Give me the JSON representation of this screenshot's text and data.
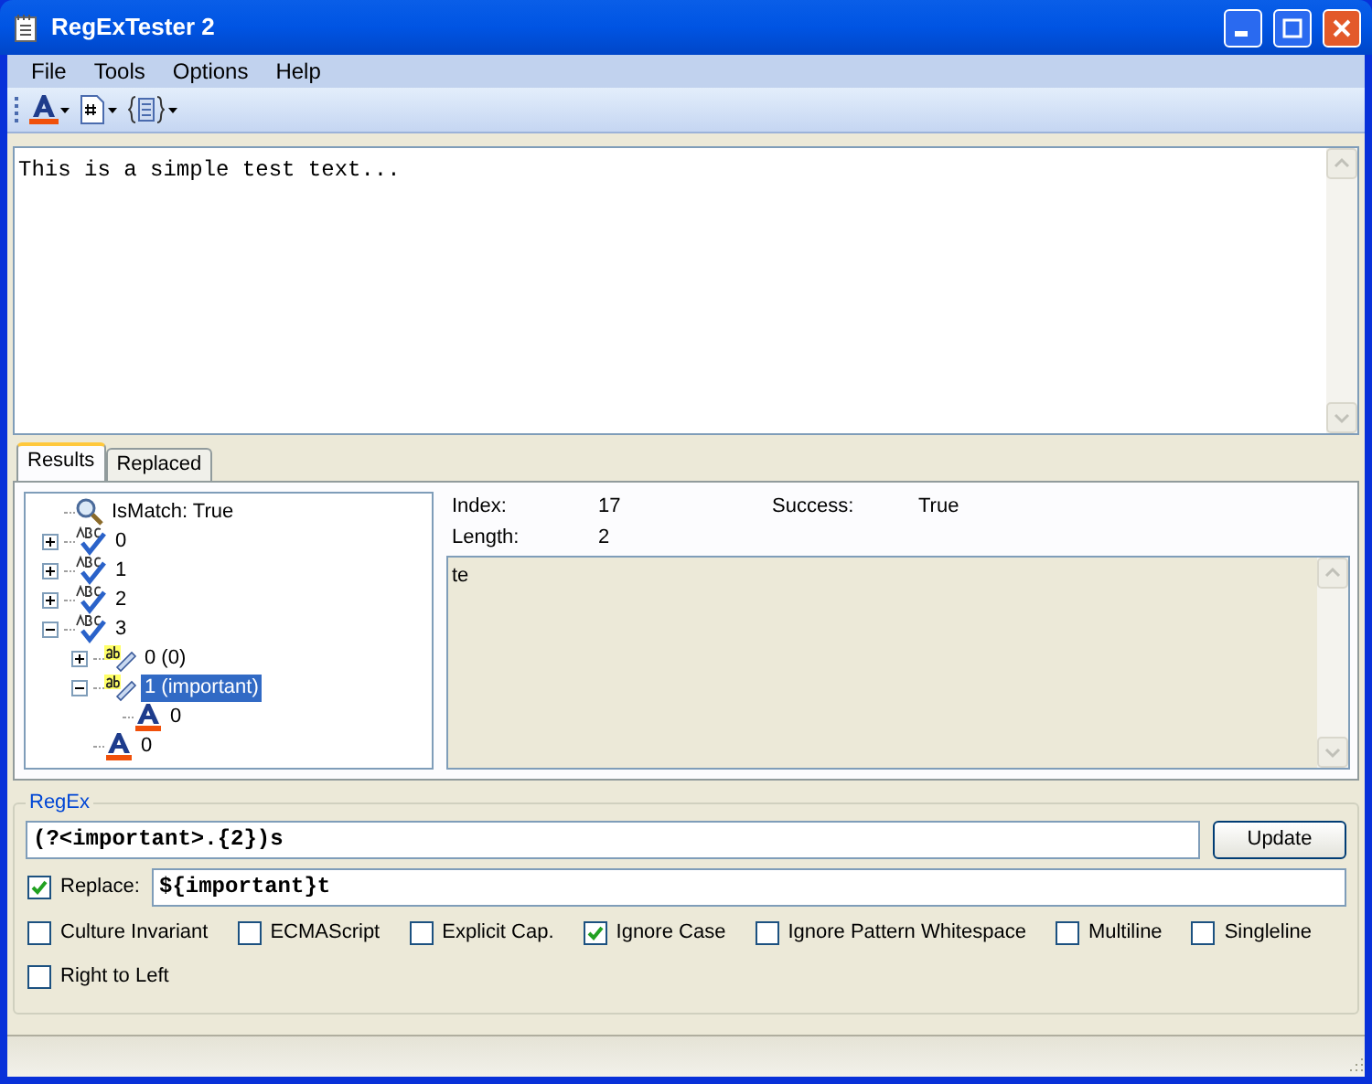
{
  "window": {
    "title": "RegExTester 2"
  },
  "menu": [
    "File",
    "Tools",
    "Options",
    "Help"
  ],
  "input_text": "This is a simple test text...",
  "tabs": [
    {
      "label": "Results",
      "selected": true
    },
    {
      "label": "Replaced",
      "selected": false
    }
  ],
  "tree": [
    {
      "kind": "ismatch",
      "label": "IsMatch: True",
      "selected": false
    },
    {
      "kind": "match",
      "label": "0",
      "selected": false,
      "expanded": false
    },
    {
      "kind": "match",
      "label": "1",
      "selected": false,
      "expanded": false
    },
    {
      "kind": "match",
      "label": "2",
      "selected": false,
      "expanded": false
    },
    {
      "kind": "match",
      "label": "3",
      "selected": false,
      "expanded": true,
      "children": [
        {
          "kind": "group",
          "label": "0 (0)",
          "selected": false,
          "expanded": false
        },
        {
          "kind": "group",
          "label": "1 (important)",
          "selected": true,
          "expanded": true,
          "children": [
            {
              "kind": "capture",
              "label": "0",
              "selected": false
            }
          ]
        },
        {
          "kind": "capture",
          "label": "0",
          "selected": false
        }
      ]
    }
  ],
  "details": [
    {
      "label": "Index:",
      "value": "17"
    },
    {
      "label": "Success:",
      "value": "True"
    },
    {
      "label": "Length:",
      "value": "2"
    }
  ],
  "match_value": "te",
  "regex": {
    "title": "RegEx",
    "pattern": "(?<important>.{2})s",
    "update_button": "Update",
    "replace_label": "Replace:",
    "replace_checked": true,
    "replacement": "${important}t",
    "options": [
      {
        "label": "Culture Invariant",
        "checked": false
      },
      {
        "label": "ECMAScript",
        "checked": false
      },
      {
        "label": "Explicit Cap.",
        "checked": false
      },
      {
        "label": "Ignore Case",
        "checked": true
      },
      {
        "label": "Ignore Pattern Whitespace",
        "checked": false
      },
      {
        "label": "Multiline",
        "checked": false
      },
      {
        "label": "Singleline",
        "checked": false
      },
      {
        "label": "Right to Left",
        "checked": false
      }
    ]
  }
}
